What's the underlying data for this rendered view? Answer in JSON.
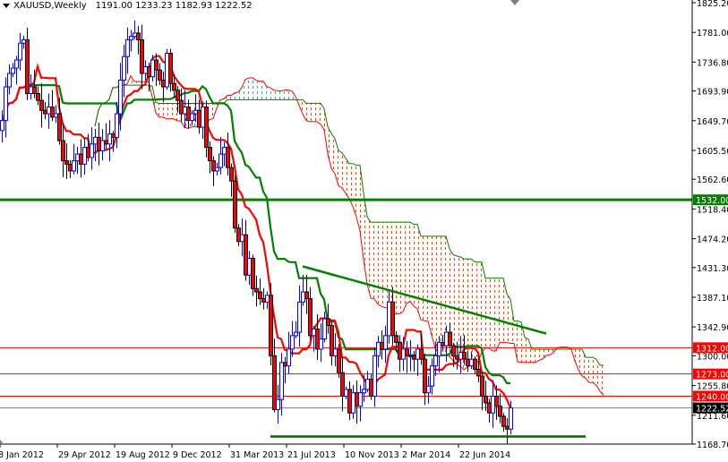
{
  "header": {
    "symbol_timeframe": "XAUUSD,Weekly",
    "ohlc_text": "1191.00 1233.23 1182.93 1222.52"
  },
  "colors": {
    "bull_candle": "#0000ff",
    "bear_candle": "#ff0000",
    "tenkan": "#ff0000",
    "kijun": "#008000",
    "cloud_bull": "#3cb371",
    "cloud_bear": "#ff4500",
    "resistance": "#ff0000",
    "support": "#008000",
    "bid_line": "#708090"
  },
  "chart_data": {
    "type": "candlestick",
    "symbol": "XAUUSD",
    "timeframe": "Weekly",
    "indicator": "Ichimoku",
    "ylim": [
      1168.7,
      1825.2
    ],
    "y_ticks": [
      "1825.20",
      "1781.00",
      "1736.80",
      "1693.90",
      "1649.70",
      "1605.50",
      "1562.60",
      "1518.40",
      "1474.20",
      "1431.30",
      "1387.10",
      "1342.90",
      "1300.00",
      "1255.80",
      "1211.60",
      "1168.70"
    ],
    "x_ticks": [
      "8 Jan 2012",
      "29 Apr 2012",
      "19 Aug 2012",
      "9 Dec 2012",
      "31 Mar 2013",
      "21 Jul 2013",
      "10 Nov 2013",
      "2 Mar 2014",
      "22 Jun 2014"
    ],
    "last_bar": {
      "open": 1191.0,
      "high": 1233.23,
      "low": 1182.93,
      "close": 1222.52
    },
    "close": [
      1650,
      1700,
      1720,
      1728,
      1740,
      1765,
      1770,
      1690,
      1700,
      1690,
      1680,
      1665,
      1660,
      1670,
      1655,
      1660,
      1620,
      1590,
      1585,
      1575,
      1590,
      1600,
      1585,
      1610,
      1595,
      1615,
      1625,
      1605,
      1620,
      1615,
      1630,
      1625,
      1660,
      1710,
      1745,
      1770,
      1775,
      1780,
      1770,
      1720,
      1730,
      1715,
      1740,
      1725,
      1710,
      1700,
      1750,
      1705,
      1695,
      1680,
      1660,
      1670,
      1650,
      1660,
      1665,
      1640,
      1670,
      1610,
      1590,
      1575,
      1580,
      1600,
      1610,
      1580,
      1560,
      1490,
      1470,
      1480,
      1420,
      1445,
      1400,
      1395,
      1385,
      1380,
      1390,
      1300,
      1220,
      1235,
      1290,
      1285,
      1310,
      1330,
      1335,
      1380,
      1395,
      1385,
      1330,
      1340,
      1310,
      1325,
      1355,
      1345,
      1300,
      1310,
      1275,
      1240,
      1250,
      1215,
      1245,
      1225,
      1245,
      1250,
      1265,
      1240,
      1300,
      1320,
      1310,
      1330,
      1380,
      1330,
      1320,
      1295,
      1310,
      1300,
      1300,
      1295,
      1310,
      1295,
      1245,
      1255,
      1285,
      1300,
      1320,
      1315,
      1335,
      1315,
      1300,
      1295,
      1305,
      1295,
      1285,
      1295,
      1280,
      1270,
      1240,
      1230,
      1215,
      1240,
      1225,
      1210,
      1195,
      1191,
      1222.52
    ],
    "horizontal_levels": [
      {
        "price": 1532.0,
        "label": "1532.00",
        "color": "#008000",
        "style": "thick"
      },
      {
        "price": 1312.0,
        "label": "1312.00",
        "color": "#ff0000",
        "style": "thin"
      },
      {
        "price": 1273.0,
        "label": "1273.00",
        "color": "#ff0000",
        "style": "thin"
      },
      {
        "price": 1240.0,
        "label": "1240.00",
        "color": "#ff0000",
        "style": "thin"
      },
      {
        "price": 1222.52,
        "label": "1222.52",
        "color": "#000000",
        "style": "bid"
      }
    ],
    "trendlines": [
      {
        "name": "descending-resistance",
        "from": {
          "bar": 84,
          "price": 1433
        },
        "to": {
          "bar": 152,
          "price": 1333
        },
        "color": "#008000"
      },
      {
        "name": "support",
        "from": {
          "bar": 75,
          "price": 1180
        },
        "to": {
          "bar": 163,
          "price": 1180
        },
        "color": "#006400"
      }
    ]
  }
}
